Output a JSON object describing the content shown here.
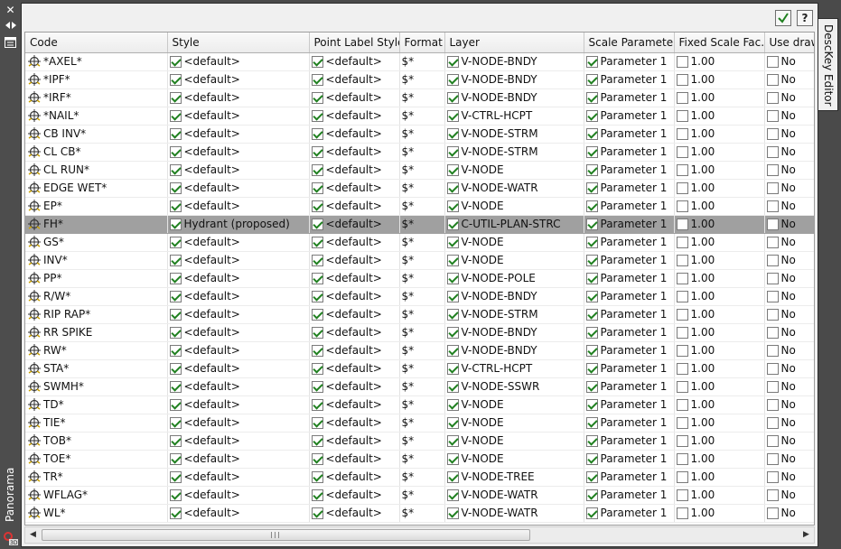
{
  "left_panel": {
    "close_glyph": "✕",
    "title": "Panorama"
  },
  "right_tab": {
    "label": "DescKey Editor"
  },
  "toolbar": {
    "help_glyph": "?"
  },
  "columns": [
    "Code",
    "Style",
    "Point Label Style",
    "Format",
    "Layer",
    "Scale Parameter",
    "Fixed Scale Fac...",
    "Use drawi"
  ],
  "rows": [
    {
      "code": "*AXEL*",
      "style": "<default>",
      "label_style": "<default>",
      "format": "$*",
      "layer": "V-NODE-BNDY",
      "scale_param": "Parameter 1",
      "fixed_scale": "1.00",
      "use_drawing": "No",
      "selected": false
    },
    {
      "code": "*IPF*",
      "style": "<default>",
      "label_style": "<default>",
      "format": "$*",
      "layer": "V-NODE-BNDY",
      "scale_param": "Parameter 1",
      "fixed_scale": "1.00",
      "use_drawing": "No",
      "selected": false
    },
    {
      "code": "*IRF*",
      "style": "<default>",
      "label_style": "<default>",
      "format": "$*",
      "layer": "V-NODE-BNDY",
      "scale_param": "Parameter 1",
      "fixed_scale": "1.00",
      "use_drawing": "No",
      "selected": false
    },
    {
      "code": "*NAIL*",
      "style": "<default>",
      "label_style": "<default>",
      "format": "$*",
      "layer": "V-CTRL-HCPT",
      "scale_param": "Parameter 1",
      "fixed_scale": "1.00",
      "use_drawing": "No",
      "selected": false
    },
    {
      "code": "CB INV*",
      "style": "<default>",
      "label_style": "<default>",
      "format": "$*",
      "layer": "V-NODE-STRM",
      "scale_param": "Parameter 1",
      "fixed_scale": "1.00",
      "use_drawing": "No",
      "selected": false
    },
    {
      "code": "CL CB*",
      "style": "<default>",
      "label_style": "<default>",
      "format": "$*",
      "layer": "V-NODE-STRM",
      "scale_param": "Parameter 1",
      "fixed_scale": "1.00",
      "use_drawing": "No",
      "selected": false
    },
    {
      "code": "CL RUN*",
      "style": "<default>",
      "label_style": "<default>",
      "format": "$*",
      "layer": "V-NODE",
      "scale_param": "Parameter 1",
      "fixed_scale": "1.00",
      "use_drawing": "No",
      "selected": false
    },
    {
      "code": "EDGE WET*",
      "style": "<default>",
      "label_style": "<default>",
      "format": "$*",
      "layer": "V-NODE-WATR",
      "scale_param": "Parameter 1",
      "fixed_scale": "1.00",
      "use_drawing": "No",
      "selected": false
    },
    {
      "code": "EP*",
      "style": "<default>",
      "label_style": "<default>",
      "format": "$*",
      "layer": "V-NODE",
      "scale_param": "Parameter 1",
      "fixed_scale": "1.00",
      "use_drawing": "No",
      "selected": false
    },
    {
      "code": "FH*",
      "style": "Hydrant (proposed)",
      "label_style": "<default>",
      "format": "$*",
      "layer": "C-UTIL-PLAN-STRC",
      "scale_param": "Parameter 1",
      "fixed_scale": "1.00",
      "use_drawing": "No",
      "selected": true
    },
    {
      "code": "GS*",
      "style": "<default>",
      "label_style": "<default>",
      "format": "$*",
      "layer": "V-NODE",
      "scale_param": "Parameter 1",
      "fixed_scale": "1.00",
      "use_drawing": "No",
      "selected": false
    },
    {
      "code": "INV*",
      "style": "<default>",
      "label_style": "<default>",
      "format": "$*",
      "layer": "V-NODE",
      "scale_param": "Parameter 1",
      "fixed_scale": "1.00",
      "use_drawing": "No",
      "selected": false
    },
    {
      "code": "PP*",
      "style": "<default>",
      "label_style": "<default>",
      "format": "$*",
      "layer": "V-NODE-POLE",
      "scale_param": "Parameter 1",
      "fixed_scale": "1.00",
      "use_drawing": "No",
      "selected": false
    },
    {
      "code": "R/W*",
      "style": "<default>",
      "label_style": "<default>",
      "format": "$*",
      "layer": "V-NODE-BNDY",
      "scale_param": "Parameter 1",
      "fixed_scale": "1.00",
      "use_drawing": "No",
      "selected": false
    },
    {
      "code": "RIP RAP*",
      "style": "<default>",
      "label_style": "<default>",
      "format": "$*",
      "layer": "V-NODE-STRM",
      "scale_param": "Parameter 1",
      "fixed_scale": "1.00",
      "use_drawing": "No",
      "selected": false
    },
    {
      "code": "RR SPIKE",
      "style": "<default>",
      "label_style": "<default>",
      "format": "$*",
      "layer": "V-NODE-BNDY",
      "scale_param": "Parameter 1",
      "fixed_scale": "1.00",
      "use_drawing": "No",
      "selected": false
    },
    {
      "code": "RW*",
      "style": "<default>",
      "label_style": "<default>",
      "format": "$*",
      "layer": "V-NODE-BNDY",
      "scale_param": "Parameter 1",
      "fixed_scale": "1.00",
      "use_drawing": "No",
      "selected": false
    },
    {
      "code": "STA*",
      "style": "<default>",
      "label_style": "<default>",
      "format": "$*",
      "layer": "V-CTRL-HCPT",
      "scale_param": "Parameter 1",
      "fixed_scale": "1.00",
      "use_drawing": "No",
      "selected": false
    },
    {
      "code": "SWMH*",
      "style": "<default>",
      "label_style": "<default>",
      "format": "$*",
      "layer": "V-NODE-SSWR",
      "scale_param": "Parameter 1",
      "fixed_scale": "1.00",
      "use_drawing": "No",
      "selected": false
    },
    {
      "code": "TD*",
      "style": "<default>",
      "label_style": "<default>",
      "format": "$*",
      "layer": "V-NODE",
      "scale_param": "Parameter 1",
      "fixed_scale": "1.00",
      "use_drawing": "No",
      "selected": false
    },
    {
      "code": "TIE*",
      "style": "<default>",
      "label_style": "<default>",
      "format": "$*",
      "layer": "V-NODE",
      "scale_param": "Parameter 1",
      "fixed_scale": "1.00",
      "use_drawing": "No",
      "selected": false
    },
    {
      "code": "TOB*",
      "style": "<default>",
      "label_style": "<default>",
      "format": "$*",
      "layer": "V-NODE",
      "scale_param": "Parameter 1",
      "fixed_scale": "1.00",
      "use_drawing": "No",
      "selected": false
    },
    {
      "code": "TOE*",
      "style": "<default>",
      "label_style": "<default>",
      "format": "$*",
      "layer": "V-NODE",
      "scale_param": "Parameter 1",
      "fixed_scale": "1.00",
      "use_drawing": "No",
      "selected": false
    },
    {
      "code": "TR*",
      "style": "<default>",
      "label_style": "<default>",
      "format": "$*",
      "layer": "V-NODE-TREE",
      "scale_param": "Parameter 1",
      "fixed_scale": "1.00",
      "use_drawing": "No",
      "selected": false
    },
    {
      "code": "WFLAG*",
      "style": "<default>",
      "label_style": "<default>",
      "format": "$*",
      "layer": "V-NODE-WATR",
      "scale_param": "Parameter 1",
      "fixed_scale": "1.00",
      "use_drawing": "No",
      "selected": false
    },
    {
      "code": "WL*",
      "style": "<default>",
      "label_style": "<default>",
      "format": "$*",
      "layer": "V-NODE-WATR",
      "scale_param": "Parameter 1",
      "fixed_scale": "1.00",
      "use_drawing": "No",
      "selected": false
    }
  ],
  "checkbox_states": {
    "style": true,
    "label_style": true,
    "layer": true,
    "scale_param": true,
    "fixed_scale": false,
    "use_drawing": false
  },
  "colors": {
    "selected_row": "#a0a0a0",
    "check_mark": "#208020",
    "frame": "#4a4a4a"
  },
  "icons": [
    "close-icon",
    "auto-hide-icon",
    "properties-icon",
    "point-marker-icon",
    "checkmark-icon",
    "help-icon",
    "autocad-logo-icon"
  ]
}
